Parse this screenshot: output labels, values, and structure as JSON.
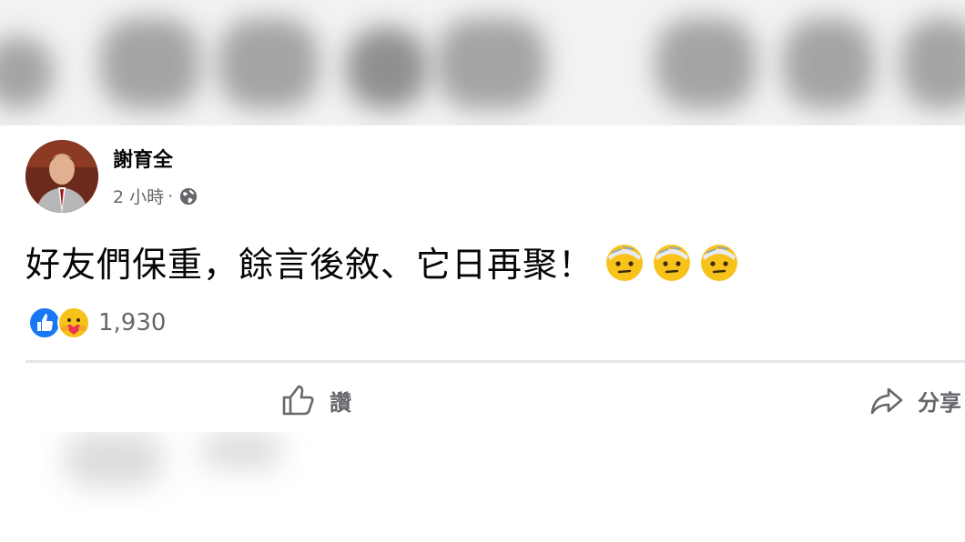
{
  "post": {
    "author": "謝育全",
    "time": "2 小時",
    "separator": "·",
    "text": "好友們保重，餘言後敘、它日再聚！",
    "emojis": [
      "face-with-head-bandage-icon",
      "face-with-head-bandage-icon",
      "face-with-head-bandage-icon"
    ]
  },
  "reactions": {
    "icons": [
      "like-reaction-icon",
      "care-reaction-icon"
    ],
    "count": "1,930"
  },
  "actions": {
    "like_label": "讚",
    "share_label": "分享"
  },
  "colors": {
    "text": "#050505",
    "secondary": "#65676b",
    "like_blue": "#1877f2",
    "divider": "#e4e6eb"
  }
}
